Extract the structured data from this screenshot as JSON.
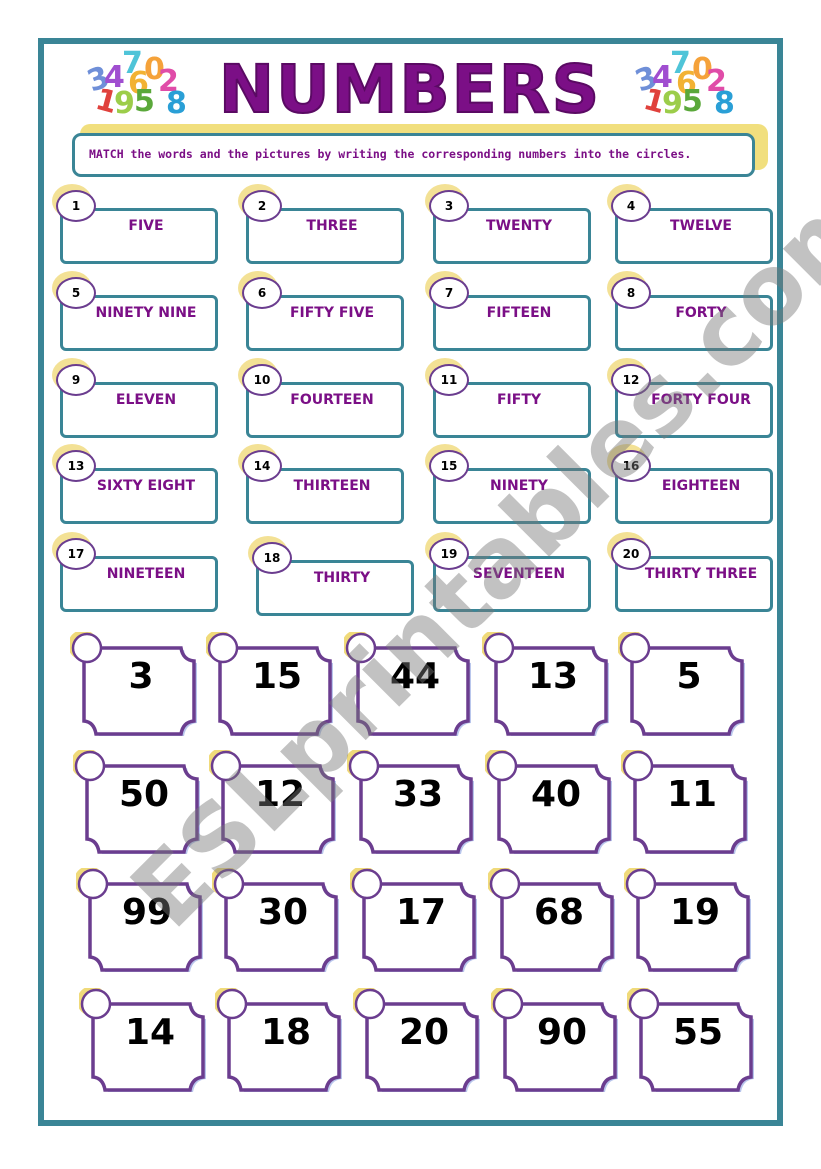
{
  "title": "NUMBERS",
  "logo_digits": [
    "3",
    "4",
    "7",
    "6",
    "0",
    "2",
    "1",
    "9",
    "5",
    "8"
  ],
  "instruction": "MATCH the words and the pictures by writing the corresponding numbers into the circles.",
  "word_cards": [
    {
      "n": "1",
      "word": "FIVE"
    },
    {
      "n": "2",
      "word": "THREE"
    },
    {
      "n": "3",
      "word": "TWENTY"
    },
    {
      "n": "4",
      "word": "TWELVE"
    },
    {
      "n": "5",
      "word": "NINETY NINE"
    },
    {
      "n": "6",
      "word": "FIFTY FIVE"
    },
    {
      "n": "7",
      "word": "FIFTEEN"
    },
    {
      "n": "8",
      "word": "FORTY"
    },
    {
      "n": "9",
      "word": "ELEVEN"
    },
    {
      "n": "10",
      "word": "FOURTEEN"
    },
    {
      "n": "11",
      "word": "FIFTY"
    },
    {
      "n": "12",
      "word": "FORTY FOUR"
    },
    {
      "n": "13",
      "word": "SIXTY EIGHT"
    },
    {
      "n": "14",
      "word": "THIRTEEN"
    },
    {
      "n": "15",
      "word": "NINETY"
    },
    {
      "n": "16",
      "word": "EIGHTEEN"
    },
    {
      "n": "17",
      "word": "NINETEEN"
    },
    {
      "n": "18",
      "word": "THIRTY"
    },
    {
      "n": "19",
      "word": "SEVENTEEN"
    },
    {
      "n": "20",
      "word": "THIRTY THREE"
    }
  ],
  "number_cards": [
    "3",
    "15",
    "44",
    "13",
    "5",
    "50",
    "12",
    "33",
    "40",
    "11",
    "99",
    "30",
    "17",
    "68",
    "19",
    "14",
    "18",
    "20",
    "90",
    "55"
  ],
  "watermark": "ESLprintables.com",
  "colors": {
    "frame": "#3a8596",
    "title": "#7b0f86",
    "card_border": "#6b3d8f",
    "highlight": "#f0da7a"
  }
}
